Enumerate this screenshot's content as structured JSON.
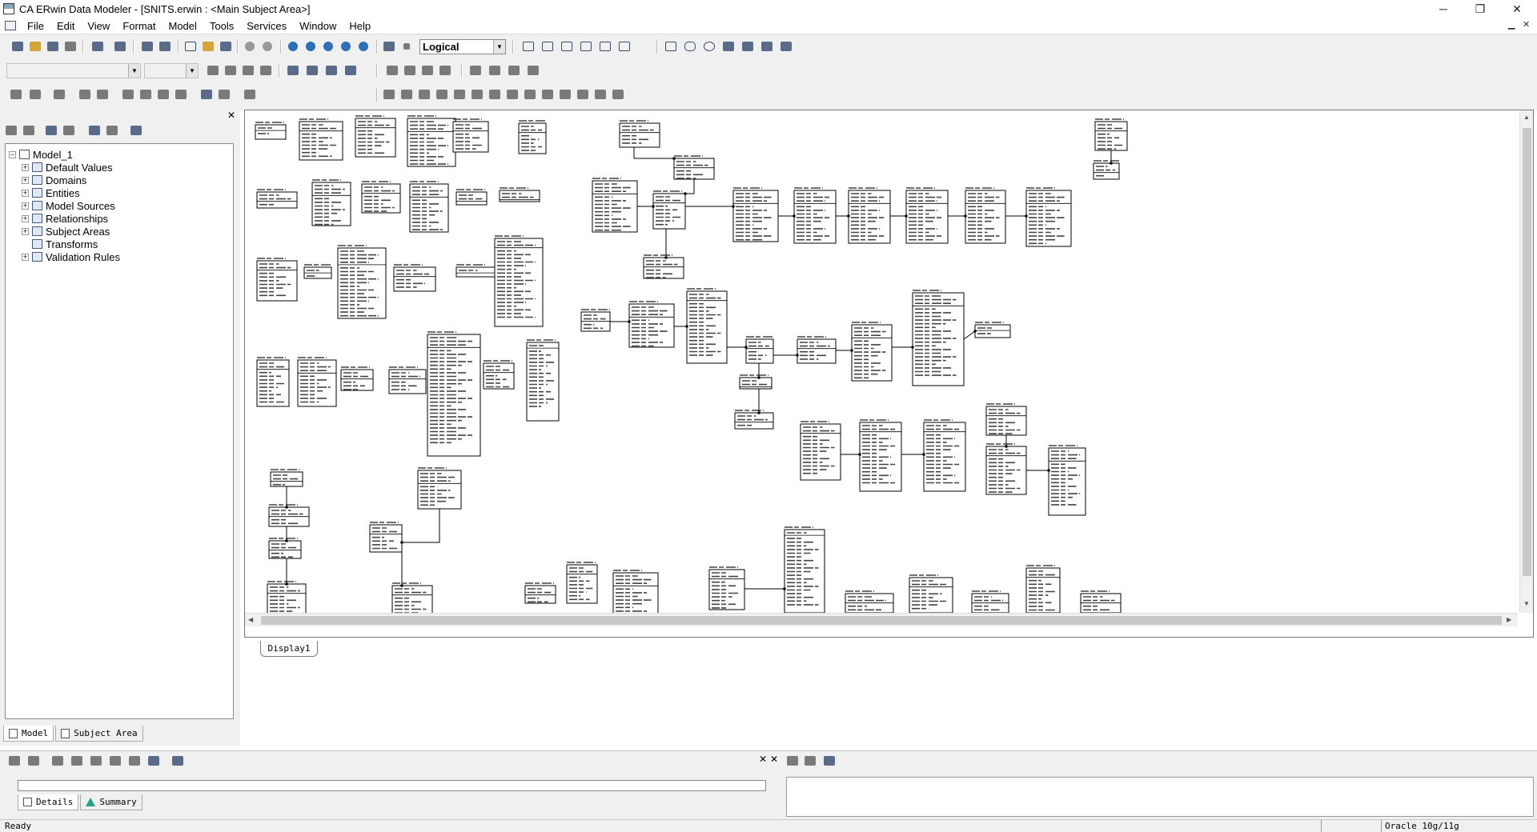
{
  "window": {
    "title": "CA ERwin Data Modeler - [SNITS.erwin : <Main Subject Area>]",
    "controls": {
      "minimize": "─",
      "restore": "❐",
      "close": "✕"
    }
  },
  "menu": {
    "items": [
      "File",
      "Edit",
      "View",
      "Format",
      "Model",
      "Tools",
      "Services",
      "Window",
      "Help"
    ]
  },
  "toolbar": {
    "view_level": "Logical"
  },
  "explorer": {
    "root": "Model_1",
    "items": [
      {
        "label": "Default Values"
      },
      {
        "label": "Domains"
      },
      {
        "label": "Entities"
      },
      {
        "label": "Model Sources"
      },
      {
        "label": "Relationships"
      },
      {
        "label": "Subject Areas"
      },
      {
        "label": "Transforms"
      },
      {
        "label": "Validation Rules"
      }
    ],
    "tabs": [
      "Model",
      "Subject Area"
    ]
  },
  "canvas": {
    "tabs": [
      "Display1"
    ]
  },
  "bottom": {
    "tabs": [
      "Details",
      "Summary"
    ]
  },
  "status": {
    "left": "Ready",
    "right": "Oracle 10g/11g"
  }
}
